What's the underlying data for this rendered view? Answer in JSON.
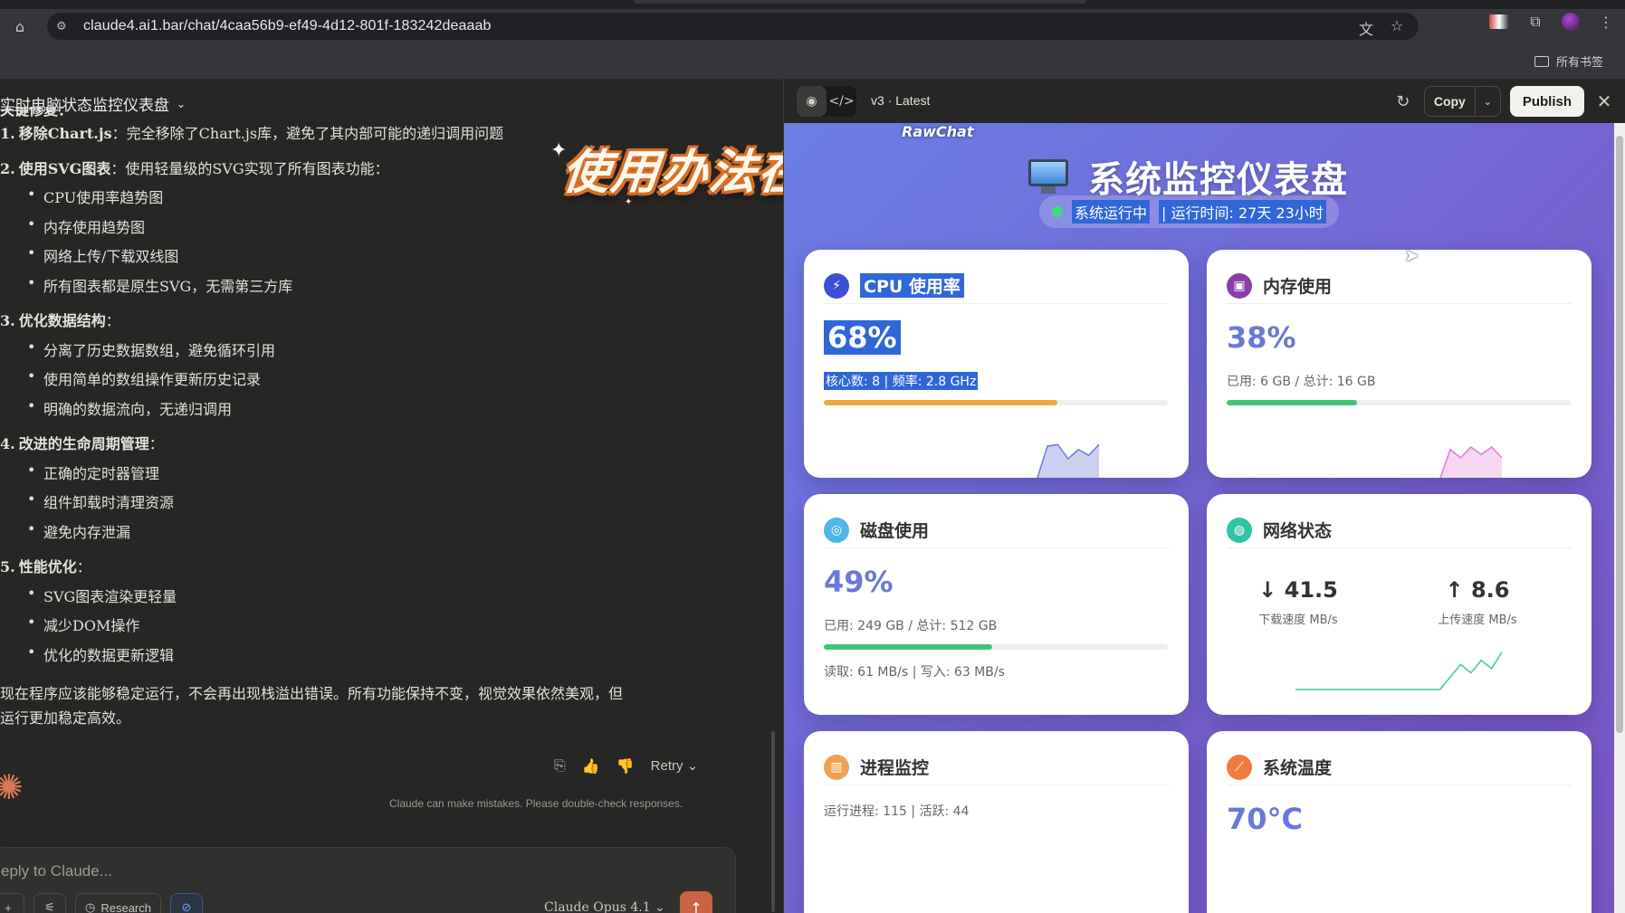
{
  "browser": {
    "url": "claude4.ai1.bar/chat/4caa56b9-ef49-4d12-801f-183242deaaab",
    "bookmarks_label": "所有书签"
  },
  "chat": {
    "title": "实时电脑状态监控仪表盘",
    "cut_heading": "关键修复：",
    "sections": [
      {
        "num": "1.",
        "head": "移除Chart.js",
        "text": "：完全移除了Chart.js库，避免了其内部可能的递归调用问题",
        "bullets": []
      },
      {
        "num": "2.",
        "head": "使用SVG图表",
        "text": "：使用轻量级的SVG实现了所有图表功能：",
        "bullets": [
          "CPU使用率趋势图",
          "内存使用趋势图",
          "网络上传/下载双线图",
          "所有图表都是原生SVG，无需第三方库"
        ]
      },
      {
        "num": "3.",
        "head": "优化数据结构",
        "text": "：",
        "bullets": [
          "分离了历史数据数组，避免循环引用",
          "使用简单的数组操作更新历史记录",
          "明确的数据流向，无递归调用"
        ]
      },
      {
        "num": "4.",
        "head": "改进的生命周期管理",
        "text": "：",
        "bullets": [
          "正确的定时器管理",
          "组件卸载时清理资源",
          "避免内存泄漏"
        ]
      },
      {
        "num": "5.",
        "head": "性能优化",
        "text": "：",
        "bullets": [
          "SVG图表渲染更轻量",
          "减少DOM操作",
          "优化的数据更新逻辑"
        ]
      }
    ],
    "summary_line1": "现在程序应该能够稳定运行，不会再出现栈溢出错误。所有功能保持不变，视觉效果依然美观，但",
    "summary_line2": "运行更加稳定高效。",
    "retry_label": "Retry",
    "disclaimer": "Claude can make mistakes. Please double-check responses.",
    "input_placeholder": "eply to Claude...",
    "research_label": "Research",
    "model_label": "Claude Opus 4.1"
  },
  "overlay": {
    "caption": "使用办法在视频简介",
    "watermark": "RawChat"
  },
  "artifact": {
    "version_label": "v3 · Latest",
    "copy_label": "Copy",
    "publish_label": "Publish"
  },
  "dashboard": {
    "title": "系统监控仪表盘",
    "status_text": "系统运行中",
    "uptime_text": "| 运行时间: 27天 23小时",
    "cpu": {
      "title": "CPU 使用率",
      "value": "68%",
      "detail": "核心数: 8 | 频率: 2.8 GHz",
      "percent": 68,
      "bar_color": "#f0a83a",
      "history": [
        0,
        0,
        0,
        0,
        0,
        0,
        0,
        0,
        0,
        0,
        0,
        0,
        0,
        0,
        0,
        78,
        82,
        48,
        70,
        56,
        82
      ]
    },
    "memory": {
      "title": "内存使用",
      "value": "38%",
      "detail": "已用: 6 GB / 总计: 16 GB",
      "percent": 38,
      "bar_color": "#3cc67a",
      "history": [
        0,
        0,
        0,
        0,
        0,
        0,
        0,
        0,
        0,
        0,
        0,
        0,
        0,
        0,
        0,
        70,
        50,
        76,
        58,
        76,
        50
      ]
    },
    "disk": {
      "title": "磁盘使用",
      "value": "49%",
      "detail": "已用: 249 GB / 总计: 512 GB",
      "io": "读取: 61 MB/s | 写入: 63 MB/s",
      "percent": 49,
      "bar_color": "#3cc67a"
    },
    "network": {
      "title": "网络状态",
      "down_value": "↓ 41.5",
      "down_label": "下载速度 MB/s",
      "up_value": "↑ 8.6",
      "up_label": "上传速度 MB/s",
      "history": [
        0,
        0,
        0,
        0,
        0,
        0,
        0,
        0,
        0,
        0,
        0,
        0,
        0,
        0,
        0,
        30,
        60,
        40,
        70,
        50,
        90
      ]
    },
    "process": {
      "title": "进程监控",
      "detail": "运行进程: 115 | 活跃: 44"
    },
    "temperature": {
      "title": "系统温度",
      "value": "70°C"
    }
  }
}
